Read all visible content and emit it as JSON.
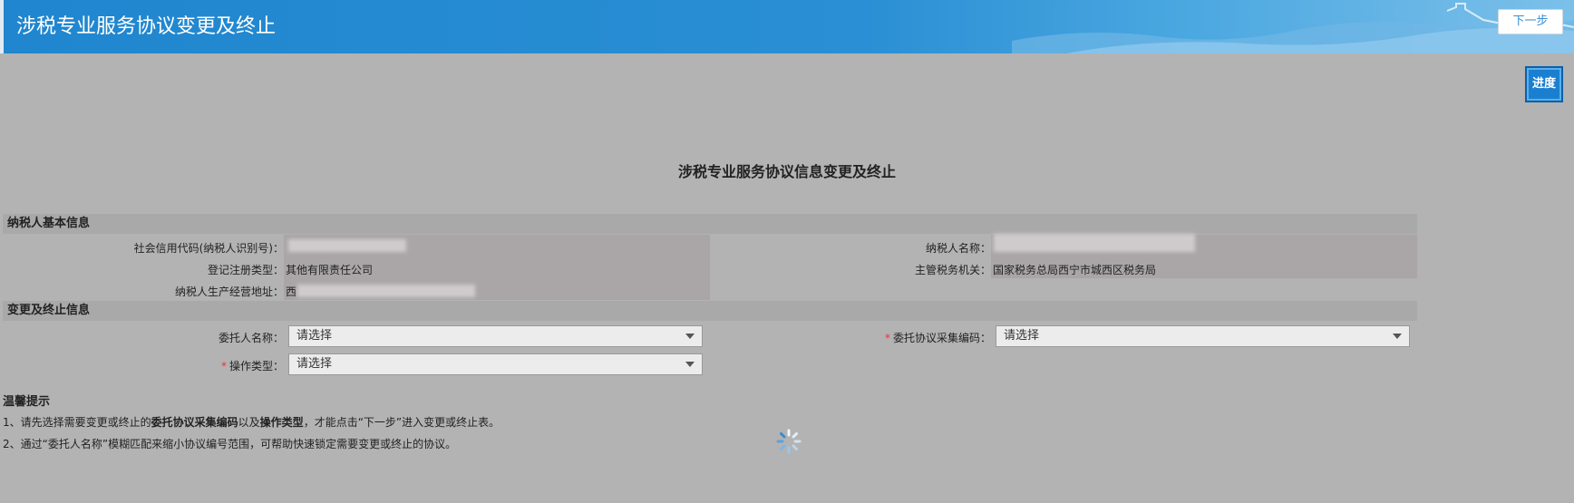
{
  "header": {
    "title": "涉税专业服务协议变更及终止",
    "next_label": "下一步"
  },
  "progress_label": "进度",
  "page_heading": "涉税专业服务协议信息变更及终止",
  "taxpayer_section": {
    "title": "纳税人基本信息",
    "credit_code_label": "社会信用代码(纳税人识别号)：",
    "name_label": "纳税人名称：",
    "reg_type_label": "登记注册类型：",
    "reg_type_value": "其他有限责任公司",
    "tax_authority_label": "主管税务机关：",
    "tax_authority_value": "国家税务总局西宁市城西区税务局",
    "address_label": "纳税人生产经营地址：",
    "address_value_prefix": "西"
  },
  "change_section": {
    "title": "变更及终止信息",
    "principal_label": "委托人名称：",
    "principal_value": "请选择",
    "agreement_code_label": "委托协议采集编码：",
    "agreement_code_value": "请选择",
    "operation_type_label": "操作类型：",
    "operation_type_value": "请选择",
    "required_mark": "*"
  },
  "tips": {
    "title": "温馨提示",
    "tip1_a": "1、请先选择需要变更或终止的",
    "tip1_b": "委托协议采集编码",
    "tip1_c": "以及",
    "tip1_d": "操作类型",
    "tip1_e": "，才能点击“下一步”进入变更或终止表。",
    "tip2": "2、通过“委托人名称”模糊匹配来缩小协议编号范围，可帮助快速锁定需要变更或终止的协议。"
  },
  "colors": {
    "header_blue": "#1f86cf",
    "overlay_gray": "#b3b3b3",
    "required_red": "#e33"
  }
}
